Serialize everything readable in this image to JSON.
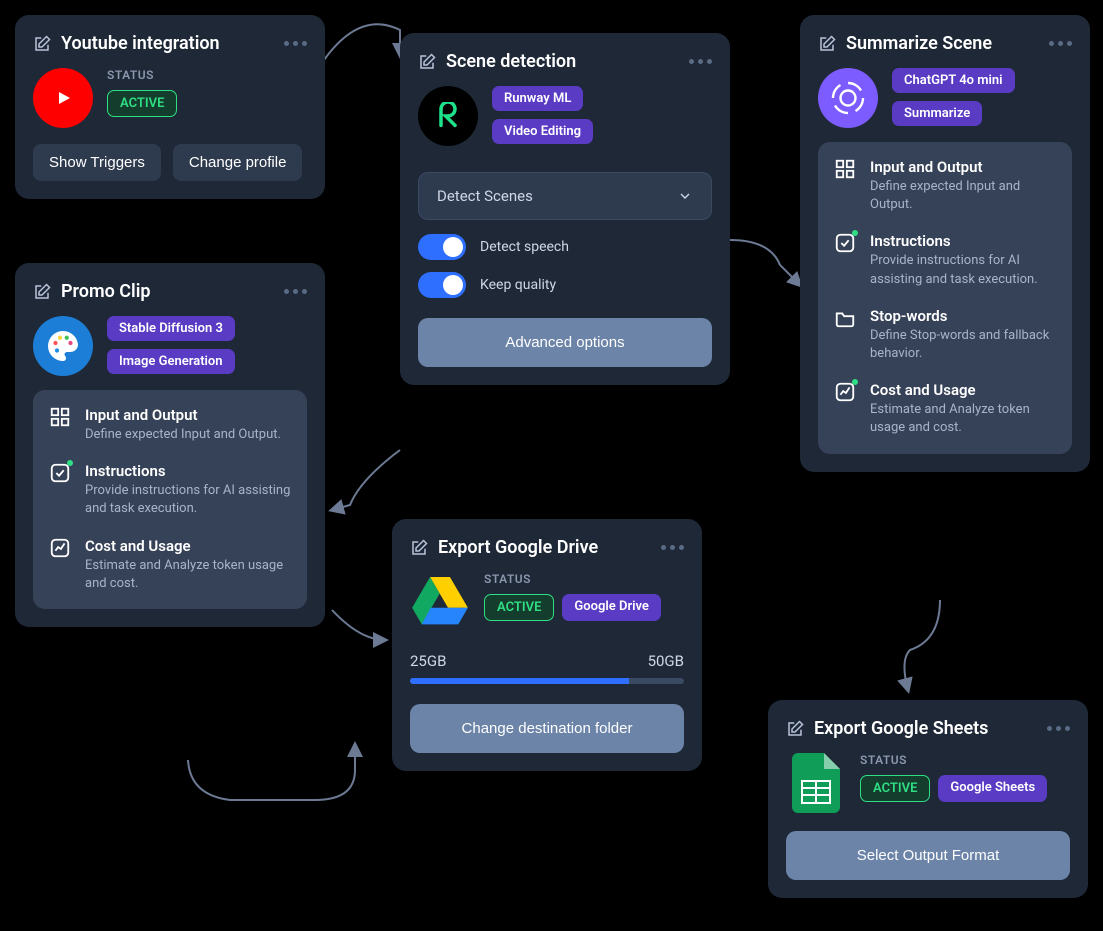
{
  "youtube": {
    "title": "Youtube integration",
    "status_label": "STATUS",
    "status": "ACTIVE",
    "show_triggers": "Show Triggers",
    "change_profile": "Change profile"
  },
  "scene": {
    "title": "Scene detection",
    "tag1": "Runway ML",
    "tag2": "Video Editing",
    "dropdown": "Detect Scenes",
    "toggle1": "Detect speech",
    "toggle2": "Keep quality",
    "advanced": "Advanced options"
  },
  "promo": {
    "title": "Promo Clip",
    "tag1": "Stable Diffusion 3",
    "tag2": "Image Generation",
    "sections": [
      {
        "title": "Input and Output",
        "desc": "Define expected Input and Output."
      },
      {
        "title": "Instructions",
        "desc": "Provide instructions for AI assisting and task execution."
      },
      {
        "title": "Cost and Usage",
        "desc": "Estimate and Analyze token usage and cost."
      }
    ]
  },
  "summarize": {
    "title": "Summarize Scene",
    "tag1": "ChatGPT 4o mini",
    "tag2": "Summarize",
    "sections": [
      {
        "title": "Input and Output",
        "desc": "Define expected Input and Output."
      },
      {
        "title": "Instructions",
        "desc": "Provide instructions for AI assisting and task execution."
      },
      {
        "title": "Stop-words",
        "desc": "Define Stop-words and fallback behavior."
      },
      {
        "title": "Cost and Usage",
        "desc": "Estimate and Analyze token usage and cost."
      }
    ]
  },
  "drive": {
    "title": "Export Google Drive",
    "status_label": "STATUS",
    "status": "ACTIVE",
    "tag": "Google Drive",
    "used": "25GB",
    "total": "50GB",
    "progress": 80,
    "button": "Change destination folder"
  },
  "sheets": {
    "title": "Export Google Sheets",
    "status_label": "STATUS",
    "status": "ACTIVE",
    "tag": "Google Sheets",
    "button": "Select Output Format"
  }
}
